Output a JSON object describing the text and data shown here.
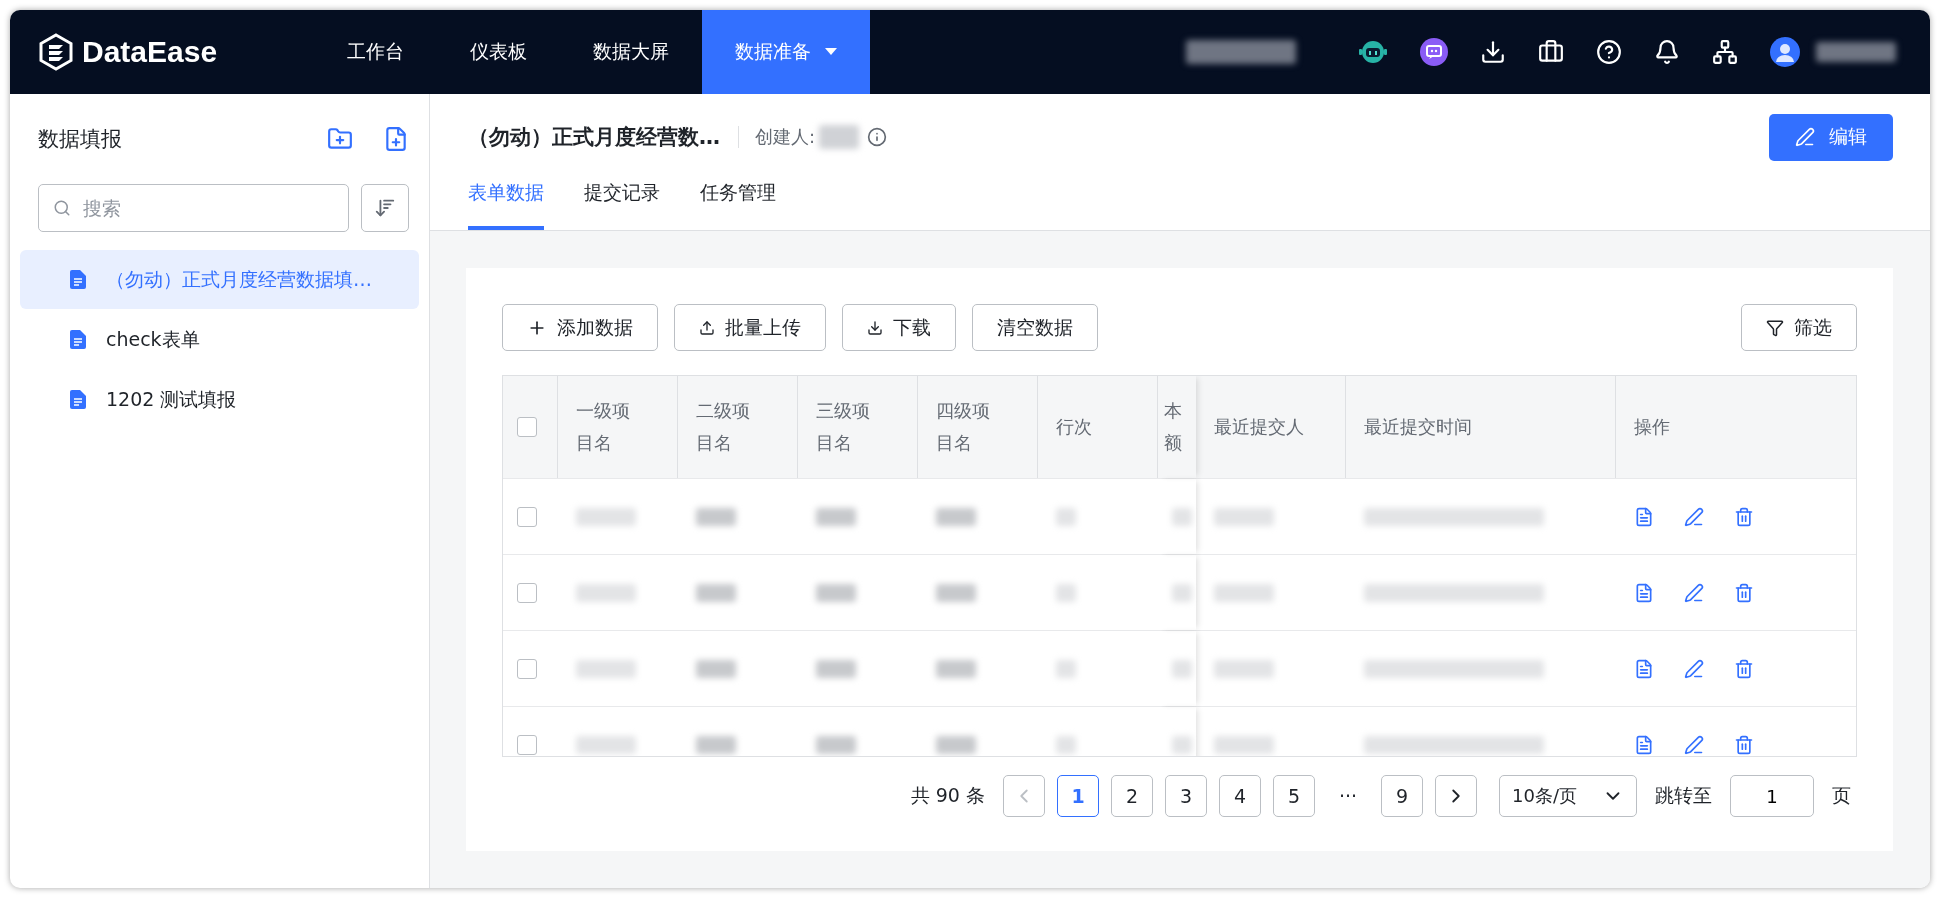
{
  "app": {
    "logo_text": "DataEase"
  },
  "nav": [
    {
      "label": "工作台",
      "selected": false
    },
    {
      "label": "仪表板",
      "selected": false
    },
    {
      "label": "数据大屏",
      "selected": false
    },
    {
      "label": "数据准备",
      "selected": true,
      "dropdown": true
    }
  ],
  "sidebar": {
    "title": "数据填报",
    "search": {
      "placeholder": "搜索"
    },
    "items": [
      {
        "label": "（勿动）正式月度经营数据填…",
        "selected": true
      },
      {
        "label": "check表单",
        "selected": false
      },
      {
        "label": "1202 测试填报",
        "selected": false
      }
    ]
  },
  "header": {
    "title": "（勿动）正式月度经营数…",
    "creator_label": "创建人:",
    "edit_button": "编辑"
  },
  "tabs": [
    {
      "label": "表单数据",
      "selected": true
    },
    {
      "label": "提交记录",
      "selected": false
    },
    {
      "label": "任务管理",
      "selected": false
    }
  ],
  "toolbar": [
    {
      "kind": "add",
      "label": "添加数据"
    },
    {
      "kind": "upload",
      "label": "批量上传"
    },
    {
      "kind": "download",
      "label": "下载"
    },
    {
      "kind": "plain",
      "label": "清空数据"
    }
  ],
  "filter_button": "筛选",
  "table": {
    "columns": [
      {
        "lines": [
          "一级项",
          "目名"
        ]
      },
      {
        "lines": [
          "二级项",
          "目名"
        ]
      },
      {
        "lines": [
          "三级项",
          "目名"
        ]
      },
      {
        "lines": [
          "四级项",
          "目名"
        ]
      },
      {
        "lines": [
          "行次"
        ]
      },
      {
        "lines": [
          "本",
          "额"
        ]
      },
      {
        "lines": [
          "最近提交人"
        ]
      },
      {
        "lines": [
          "最近提交时间"
        ]
      },
      {
        "lines": [
          "操作"
        ]
      }
    ],
    "header_checked": false,
    "rows": [
      {
        "checked": false
      },
      {
        "checked": false
      },
      {
        "checked": false
      },
      {
        "checked": false
      }
    ]
  },
  "pagination": {
    "total": "共 90 条",
    "pages": [
      {
        "label": "1",
        "selected": true
      },
      {
        "label": "2",
        "selected": false
      },
      {
        "label": "3",
        "selected": false
      },
      {
        "label": "4",
        "selected": false
      },
      {
        "label": "5",
        "selected": false
      },
      {
        "label": "···",
        "selected": false,
        "kind": "ellipsis"
      },
      {
        "label": "9",
        "selected": false
      }
    ],
    "prev_disabled": true,
    "page_size": "10条/页",
    "jump_label": "跳转至",
    "jump_value": "1",
    "page_unit": "页"
  }
}
